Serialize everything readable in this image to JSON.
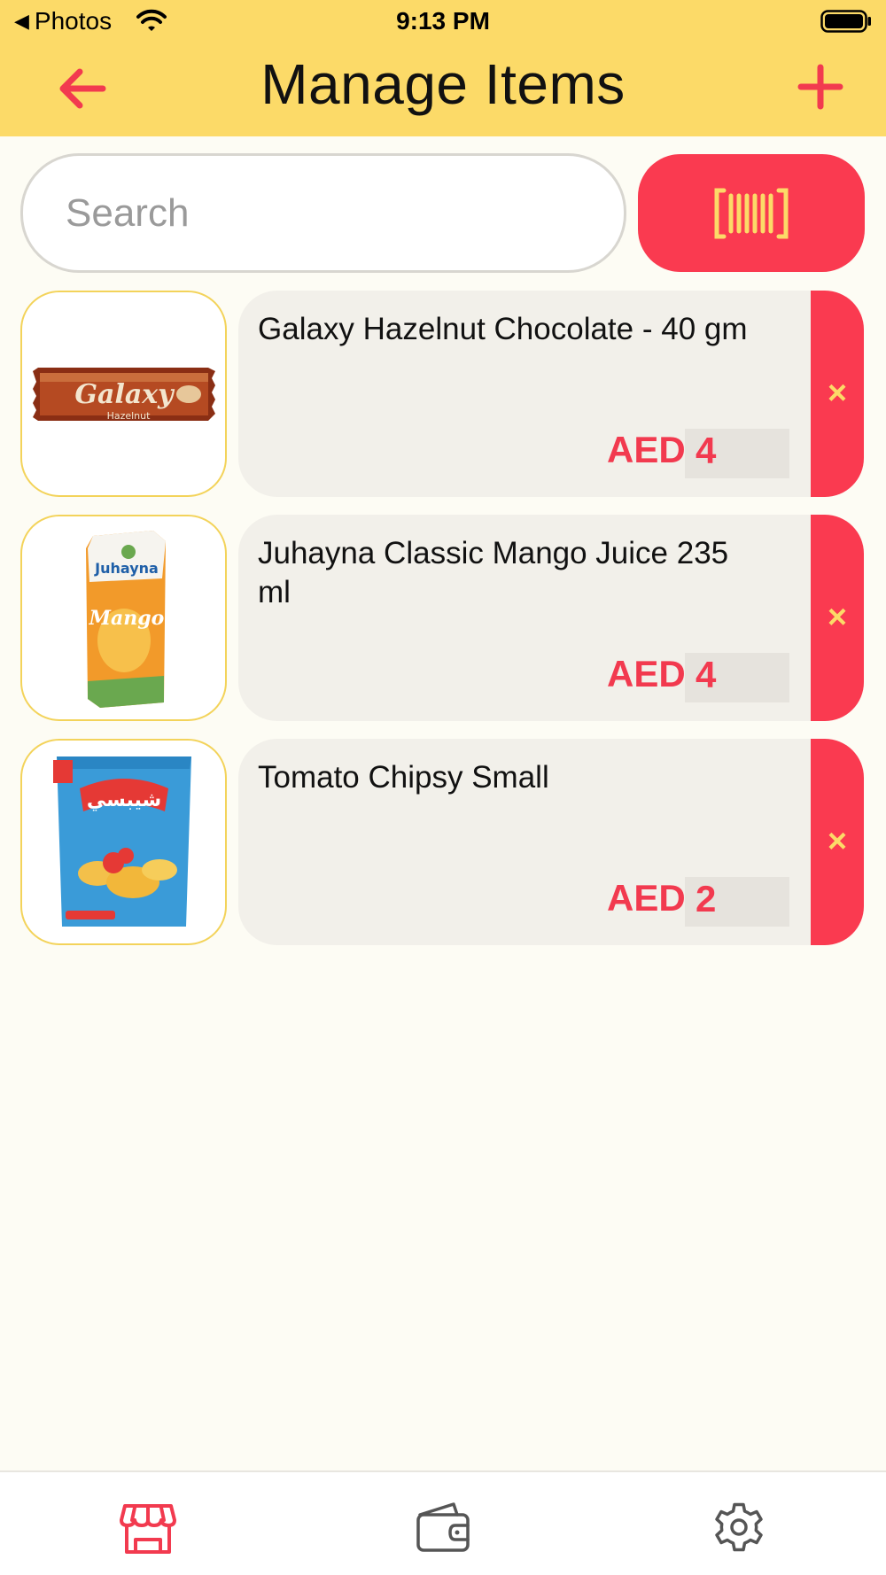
{
  "status_bar": {
    "back_app": "Photos",
    "time": "9:13 PM"
  },
  "header": {
    "title": "Manage Items"
  },
  "search": {
    "placeholder": "Search",
    "value": ""
  },
  "items": [
    {
      "name": "Galaxy Hazelnut Chocolate - 40 gm",
      "currency": "AED",
      "price": "4",
      "delete_label": "×"
    },
    {
      "name": "Juhayna Classic Mango Juice 235 ml",
      "currency": "AED",
      "price": "4",
      "delete_label": "×"
    },
    {
      "name": "Tomato Chipsy Small",
      "currency": "AED",
      "price": "2",
      "delete_label": "×"
    }
  ],
  "product_images": {
    "galaxy_wrapper_text": "Galaxy",
    "galaxy_flavor_text": "Hazelnut",
    "juhayna_brand_text": "Juhayna",
    "juhayna_flavor_text": "Mango",
    "chipsy_brand_text": "شيبسي"
  },
  "tab_bar": {
    "tabs": [
      {
        "icon": "store-icon",
        "active": true
      },
      {
        "icon": "wallet-icon",
        "active": false
      },
      {
        "icon": "gear-icon",
        "active": false
      }
    ]
  },
  "colors": {
    "header_bg": "#fcda68",
    "accent": "#fa3a50",
    "page_bg": "#fdfcf4",
    "card_bg": "#f2f0ea"
  }
}
